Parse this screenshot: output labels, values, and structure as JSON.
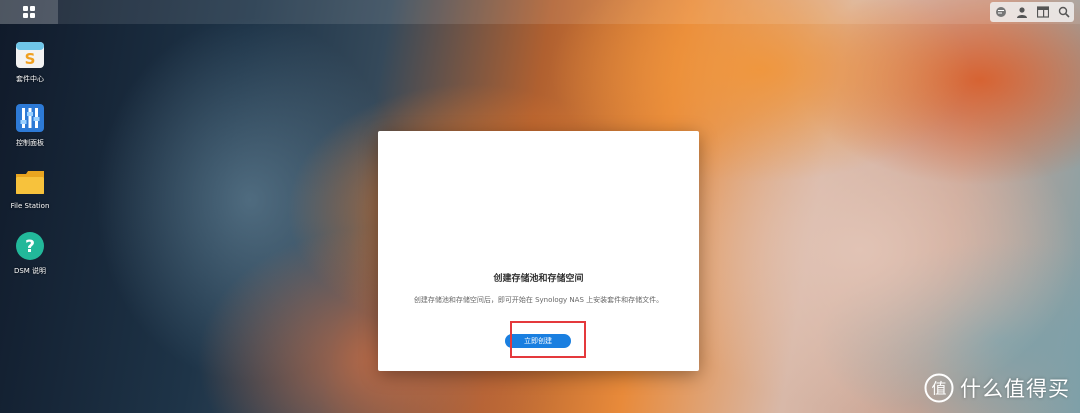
{
  "desktop": {
    "apps": [
      {
        "label": "套件中心",
        "icon": "package-center-icon"
      },
      {
        "label": "控制面板",
        "icon": "control-panel-icon"
      },
      {
        "label": "File Station",
        "icon": "folder-icon"
      },
      {
        "label": "DSM 说明",
        "icon": "help-icon"
      }
    ]
  },
  "topbar": {
    "main_menu_icon": "grid-menu-icon",
    "right_icons": [
      "notification-icon",
      "user-icon",
      "widgets-icon",
      "search-icon"
    ]
  },
  "dialog": {
    "title": "创建存储池和存储空间",
    "description": "创建存储池和存储空间后，即可开始在 Synology NAS 上安装套件和存储文件。",
    "button_label": "立即创建"
  },
  "annotation": {
    "highlight_color": "#e4393c"
  },
  "watermark": {
    "text": "什么值得买",
    "logo_char": "值"
  },
  "colors": {
    "accent": "#1a7fe0",
    "dialog_bg": "#ffffff"
  }
}
